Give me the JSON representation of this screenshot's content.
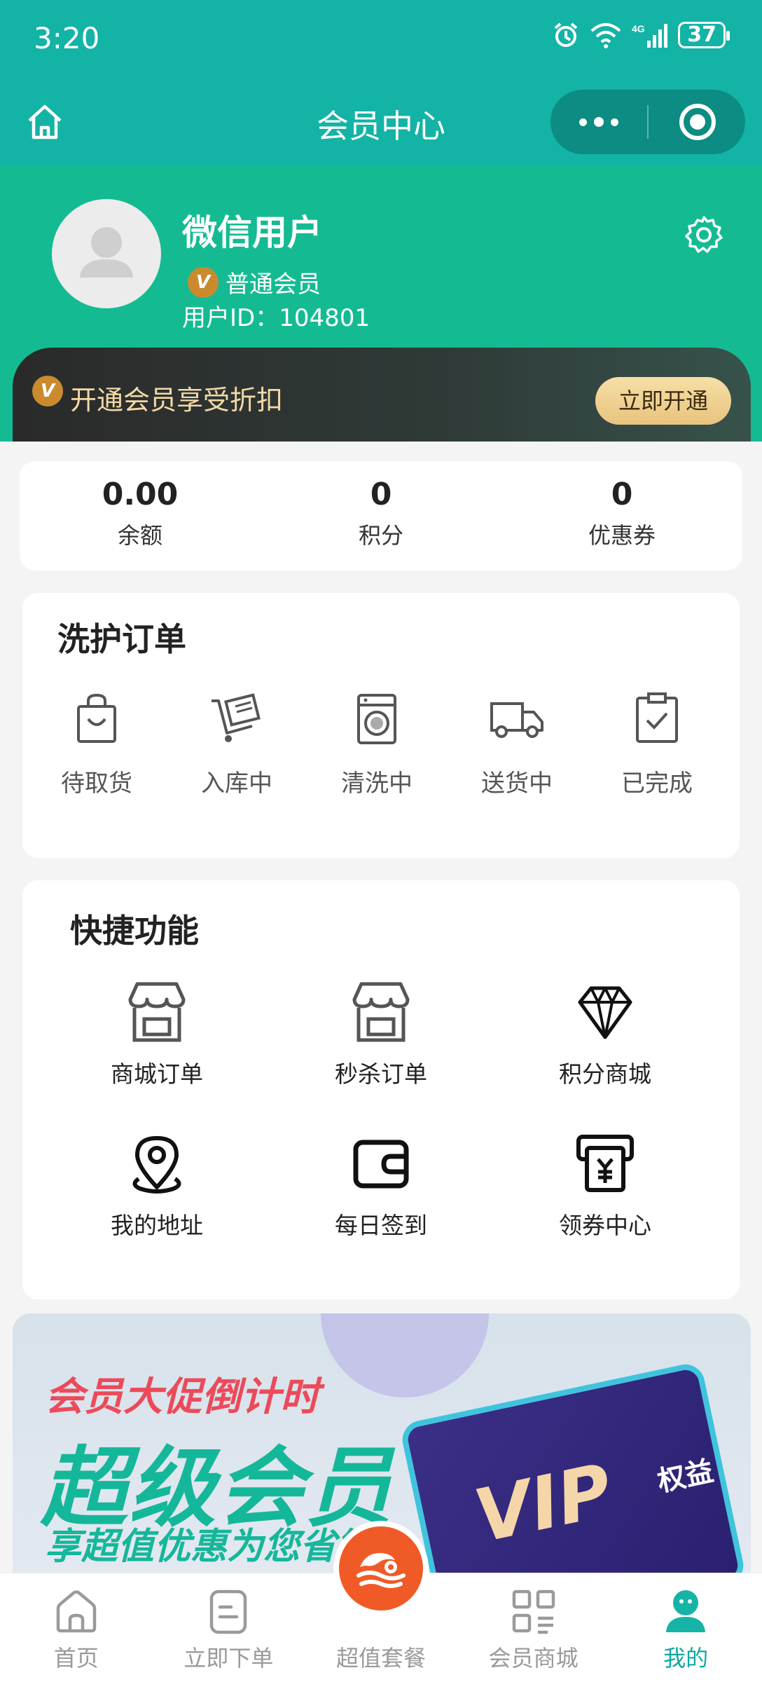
{
  "status": {
    "time": "3:20",
    "battery": "37"
  },
  "navbar": {
    "title": "会员中心"
  },
  "profile": {
    "name": "微信用户",
    "level_badge": "V",
    "level": "普通会员",
    "user_id": "用户ID：104801"
  },
  "vip_bar": {
    "text": "开通会员享受折扣",
    "button": "立即开通"
  },
  "stats": [
    {
      "value": "0.00",
      "label": "余额"
    },
    {
      "value": "0",
      "label": "积分"
    },
    {
      "value": "0",
      "label": "优惠券"
    }
  ],
  "orders": {
    "title": "洗护订单",
    "items": [
      {
        "label": "待取货",
        "icon": "bag-icon"
      },
      {
        "label": "入库中",
        "icon": "cart-icon"
      },
      {
        "label": "清洗中",
        "icon": "washer-icon"
      },
      {
        "label": "送货中",
        "icon": "truck-icon"
      },
      {
        "label": "已完成",
        "icon": "clipboard-check-icon"
      }
    ]
  },
  "quick": {
    "title": "快捷功能",
    "items": [
      {
        "label": "商城订单",
        "icon": "store-icon"
      },
      {
        "label": "秒杀订单",
        "icon": "store-icon"
      },
      {
        "label": "积分商城",
        "icon": "diamond-icon"
      },
      {
        "label": "我的地址",
        "icon": "location-icon"
      },
      {
        "label": "每日签到",
        "icon": "wallet-icon"
      },
      {
        "label": "领券中心",
        "icon": "coupon-icon"
      }
    ]
  },
  "banner": {
    "line1": "会员大促倒计时",
    "line2": "超级会员",
    "line3": "享超值优惠为您省钱",
    "vip": "VIP",
    "vip_sub": "权益"
  },
  "tabbar": [
    {
      "label": "首页",
      "icon": "home-icon"
    },
    {
      "label": "立即下单",
      "icon": "order-icon"
    },
    {
      "label": "超值套餐",
      "icon": "package-icon"
    },
    {
      "label": "会员商城",
      "icon": "grid-icon"
    },
    {
      "label": "我的",
      "icon": "user-icon",
      "active": true
    }
  ],
  "colors": {
    "primary": "#13b3a6",
    "profile_bg": "#14bb92",
    "accent": "#0fa7a0",
    "vip_gold": "#e8c47e",
    "fab": "#f05a26"
  }
}
